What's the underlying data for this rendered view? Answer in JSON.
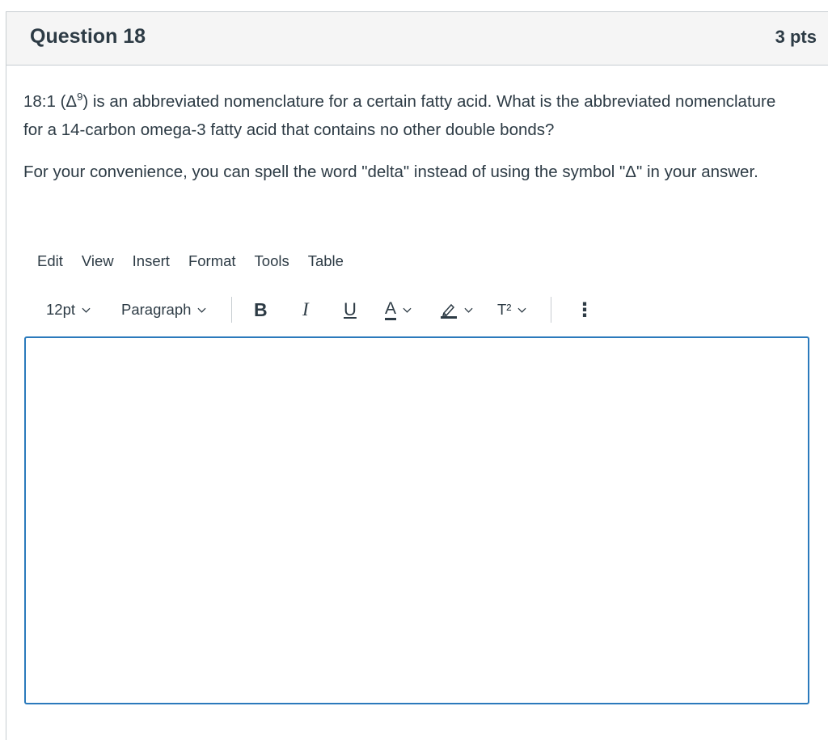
{
  "question": {
    "title": "Question 18",
    "points": "3 pts",
    "p1_before_sup": "18:1 (Δ",
    "p1_sup": "9",
    "p1_after_sup": ") is an abbreviated nomenclature for a certain fatty acid. What is the abbreviated nomenclature for a 14-carbon omega-3 fatty acid that contains no other double bonds?",
    "p2": "For your convenience, you can spell the word \"delta\" instead of using the symbol \"Δ\" in your answer."
  },
  "editor_menu": {
    "items": [
      "Edit",
      "View",
      "Insert",
      "Format",
      "Tools",
      "Table"
    ]
  },
  "toolbar": {
    "font_size": "12pt",
    "block_format": "Paragraph",
    "bold": "B",
    "italic": "I",
    "underline": "U",
    "text_color": "A",
    "superscript": "T²",
    "more": "⋮"
  },
  "editor": {
    "value": ""
  },
  "colors": {
    "accent": "#2b7abc",
    "text": "#2d3b45",
    "header_bg": "#f5f5f5",
    "border": "#c7cdd1"
  }
}
